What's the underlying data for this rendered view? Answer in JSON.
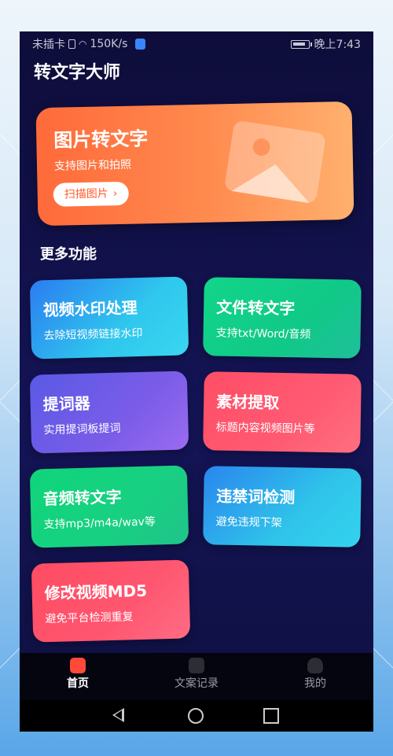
{
  "statusbar": {
    "left_text": "未插卡",
    "speed": "150K/s",
    "time": "晚上7:43"
  },
  "app": {
    "title": "转文字大师"
  },
  "hero": {
    "title": "图片转文字",
    "subtitle": "支持图片和拍照",
    "button_label": "扫描图片",
    "button_chevron": "›"
  },
  "section": {
    "title": "更多功能"
  },
  "features": [
    {
      "title": "视频水印处理",
      "subtitle": "去除短视频链接水印"
    },
    {
      "title": "文件转文字",
      "subtitle": "支持txt/Word/音频"
    },
    {
      "title": "提词器",
      "subtitle": "实用提词板提词"
    },
    {
      "title": "素材提取",
      "subtitle": "标题内容视频图片等"
    },
    {
      "title": "音频转文字",
      "subtitle": "支持mp3/m4a/wav等"
    },
    {
      "title": "违禁词检测",
      "subtitle": "避免违规下架"
    },
    {
      "title": "修改视频MD5",
      "subtitle": "避免平台检测重复"
    }
  ],
  "tabbar": [
    {
      "label": "首页",
      "icon": "home-icon",
      "active": true
    },
    {
      "label": "文案记录",
      "icon": "document-icon",
      "active": false
    },
    {
      "label": "我的",
      "icon": "person-icon",
      "active": false
    }
  ],
  "colors": {
    "hero_start": "#ff6a3a",
    "hero_end": "#ffb06e",
    "video_watermark": "#2fc7ee",
    "file_to_text": "#10c987",
    "teleprompter": "#7a5ce8",
    "material_extract": "#ff5a72",
    "audio_to_text": "#18d082",
    "forbidden_words": "#2fc3ea",
    "md5": "#ff5670",
    "tab_active": "#ff4a3a"
  }
}
